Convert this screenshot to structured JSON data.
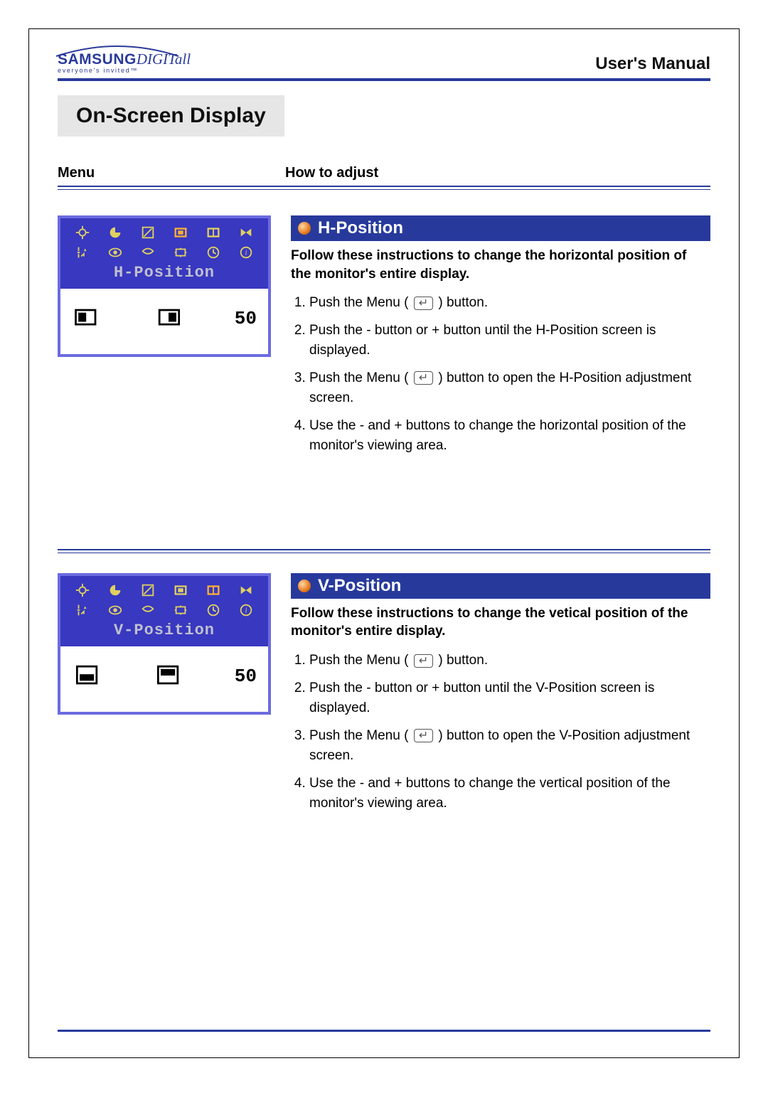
{
  "header": {
    "brand_main": "SAMSUNG",
    "brand_sub": "DIGITall",
    "tagline": "everyone's invited™",
    "manual_title": "User's Manual"
  },
  "section_title": "On-Screen Display",
  "columns": {
    "menu": "Menu",
    "howto": "How to adjust"
  },
  "entries": [
    {
      "osd_label": "H-Position",
      "osd_value": "50",
      "highlight_index_top": 3,
      "highlight_index_bot": -1,
      "feature_title": "H-Position",
      "lead": "Follow these instructions to change the horizontal position of the monitor's entire display.",
      "steps": [
        {
          "pre": "Push the Menu ( ",
          "icon": true,
          "post": " ) button."
        },
        {
          "pre": "Push the - button or + button until the H-Position screen is displayed."
        },
        {
          "pre": "Push the Menu ( ",
          "icon": true,
          "post": " ) button to open the H-Position adjustment screen."
        },
        {
          "pre": "Use the - and + buttons to change the horizontal position of the monitor's viewing area."
        }
      ]
    },
    {
      "osd_label": "V-Position",
      "osd_value": "50",
      "highlight_index_top": 4,
      "highlight_index_bot": -1,
      "feature_title": "V-Position",
      "lead": "Follow these instructions to change the vetical position of the monitor's entire display.",
      "steps": [
        {
          "pre": "Push the Menu ( ",
          "icon": true,
          "post": " ) button."
        },
        {
          "pre": "Push the - button or + button until the V-Position screen is displayed."
        },
        {
          "pre": "Push the Menu ( ",
          "icon": true,
          "post": " ) button to open the V-Position adjustment screen."
        },
        {
          "pre": "Use the - and + buttons to change the vertical position of the monitor's viewing area."
        }
      ]
    }
  ]
}
